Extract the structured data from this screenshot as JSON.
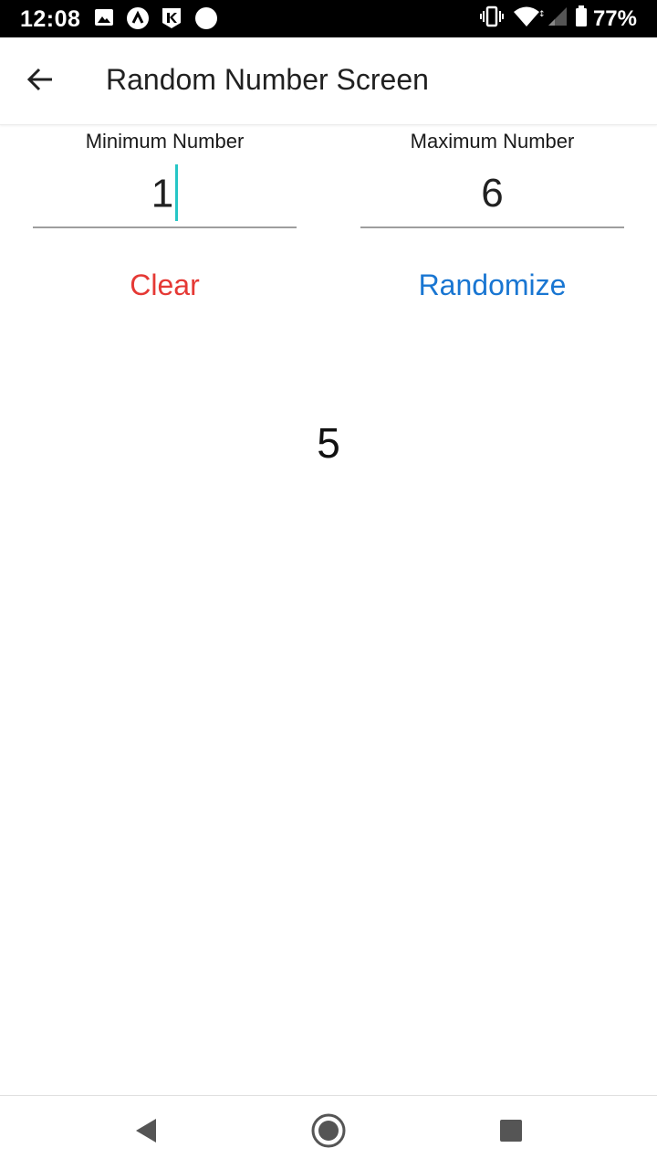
{
  "status_bar": {
    "time": "12:08",
    "battery_percent": "77%",
    "notification_icons": [
      "image-icon",
      "arc-icon",
      "k-app-icon",
      "circle-icon"
    ],
    "system_icons": [
      "vibrate-icon",
      "wifi-icon",
      "signal-icon",
      "battery-icon"
    ]
  },
  "app_bar": {
    "title": "Random Number Screen",
    "back_icon": "arrow-back-icon"
  },
  "fields": {
    "min": {
      "label": "Minimum Number",
      "value": "1",
      "focused": true
    },
    "max": {
      "label": "Maximum Number",
      "value": "6",
      "focused": false
    }
  },
  "buttons": {
    "clear_label": "Clear",
    "randomize_label": "Randomize"
  },
  "result": {
    "value": "5"
  },
  "nav_bar": {
    "back_icon": "triangle-back-icon",
    "home_icon": "home-circle-icon",
    "recents_icon": "square-recents-icon"
  },
  "colors": {
    "clear": "#e53935",
    "randomize": "#1976d2",
    "caret": "#26c6c6",
    "status_bar_bg": "#000000"
  }
}
